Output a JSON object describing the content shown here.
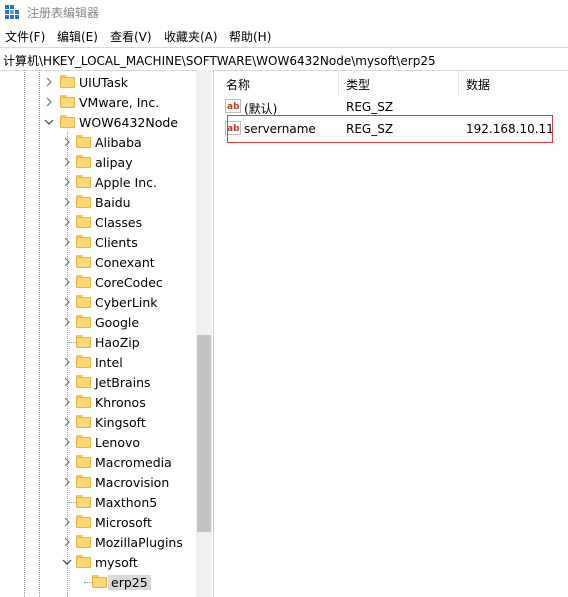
{
  "window": {
    "title": "注册表编辑器"
  },
  "menu": [
    "文件(F)",
    "编辑(E)",
    "查看(V)",
    "收藏夹(A)",
    "帮助(H)"
  ],
  "address": "计算机\\HKEY_LOCAL_MACHINE\\SOFTWARE\\WOW6432Node\\mysoft\\erp25",
  "tree": {
    "items": [
      {
        "label": "UIUTask",
        "expander": "collapsed"
      },
      {
        "label": "VMware, Inc.",
        "expander": "collapsed"
      },
      {
        "label": "WOW6432Node",
        "expander": "expanded"
      },
      {
        "label": "Alibaba",
        "expander": "collapsed"
      },
      {
        "label": "alipay",
        "expander": "collapsed"
      },
      {
        "label": "Apple Inc.",
        "expander": "collapsed"
      },
      {
        "label": "Baidu",
        "expander": "collapsed"
      },
      {
        "label": "Classes",
        "expander": "collapsed"
      },
      {
        "label": "Clients",
        "expander": "collapsed"
      },
      {
        "label": "Conexant",
        "expander": "collapsed"
      },
      {
        "label": "CoreCodec",
        "expander": "collapsed"
      },
      {
        "label": "CyberLink",
        "expander": "collapsed"
      },
      {
        "label": "Google",
        "expander": "collapsed"
      },
      {
        "label": "HaoZip",
        "expander": "none"
      },
      {
        "label": "Intel",
        "expander": "collapsed"
      },
      {
        "label": "JetBrains",
        "expander": "collapsed"
      },
      {
        "label": "Khronos",
        "expander": "collapsed"
      },
      {
        "label": "Kingsoft",
        "expander": "collapsed"
      },
      {
        "label": "Lenovo",
        "expander": "collapsed"
      },
      {
        "label": "Macromedia",
        "expander": "collapsed"
      },
      {
        "label": "Macrovision",
        "expander": "collapsed"
      },
      {
        "label": "Maxthon5",
        "expander": "none"
      },
      {
        "label": "Microsoft",
        "expander": "collapsed"
      },
      {
        "label": "MozillaPlugins",
        "expander": "collapsed"
      },
      {
        "label": "mysoft",
        "expander": "expanded"
      },
      {
        "label": "erp25",
        "expander": "none",
        "selected": true
      }
    ]
  },
  "values": {
    "columns": [
      "名称",
      "类型",
      "数据"
    ],
    "rows": [
      {
        "name": "(默认)",
        "type": "REG_SZ",
        "data": ""
      },
      {
        "name": "servername",
        "type": "REG_SZ",
        "data": "192.168.10.11",
        "highlighted": true
      }
    ]
  },
  "colors": {
    "highlight": "#e53935",
    "folder": "#fbd773",
    "selection": "#d9d9d9",
    "string_icon": "#c0392b"
  },
  "icons": {
    "app": "regedit-icon",
    "value": "string-value-icon",
    "folder": "folder-icon"
  }
}
